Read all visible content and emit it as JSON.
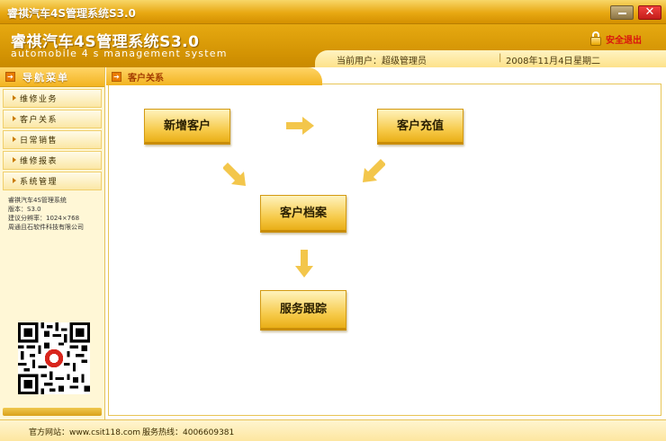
{
  "window": {
    "title": "睿祺汽车4S管理系统S3.0",
    "minimize_icon": "minimize-icon",
    "close_icon": "close-icon",
    "close_glyph": "✕"
  },
  "header": {
    "brand": "睿祺汽车4S管理系统S3.0",
    "brand_en": "automobile 4 s management system",
    "logout_label": "安全退出",
    "current_user": "当前用户：超级管理员",
    "separator": "|",
    "date": "2008年11月4日",
    "weekday": "星期二"
  },
  "sidebar": {
    "nav_title": "导航菜单",
    "items": [
      {
        "label": "维修业务"
      },
      {
        "label": "客户关系"
      },
      {
        "label": "日常销售"
      },
      {
        "label": "维修报表"
      },
      {
        "label": "系统管理"
      }
    ],
    "info": {
      "line1": "睿祺汽车4S管理系统",
      "line2": "版本：S3.0",
      "line3": "建议分辨率：1024×768",
      "line4": "周通且石软件科技有限公司"
    }
  },
  "main": {
    "breadcrumb": "客户关系",
    "flow": {
      "new_customer": "新增客户",
      "recharge": "客户充值",
      "archive": "客户档案",
      "service": "服务跟踪"
    }
  },
  "footer": {
    "website": "官方网站：www.csit118.com",
    "hotline": "服务热线：4006609381"
  },
  "colors": {
    "accent": "#e8a812",
    "arrow": "#f3c64b",
    "logout_text": "#d9140e"
  }
}
